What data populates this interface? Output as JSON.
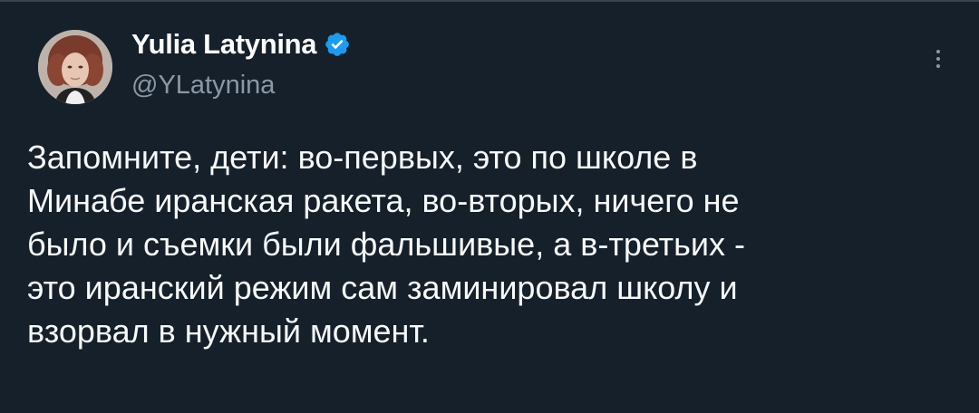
{
  "author": {
    "display_name": "Yulia Latynina",
    "handle": "@YLatynina",
    "verified": true,
    "avatar_icon": "author-avatar"
  },
  "tweet": {
    "text": "Запомните, дети: во-первых, это по школе в\nМинабе иранская ракета, во-вторых, ничего не\nбыло и съемки были фальшивые, а в-третьих -\nэто иранский режим сам заминировал школу и\nвзорвал в нужный момент."
  },
  "icons": {
    "verified": "verified-badge-icon",
    "more": "more-options-icon"
  },
  "colors": {
    "background": "#15202b",
    "text": "#f7f9f9",
    "secondary_text": "#8b98a5",
    "verified_blue": "#1d9bf0",
    "divider": "#38444d"
  }
}
